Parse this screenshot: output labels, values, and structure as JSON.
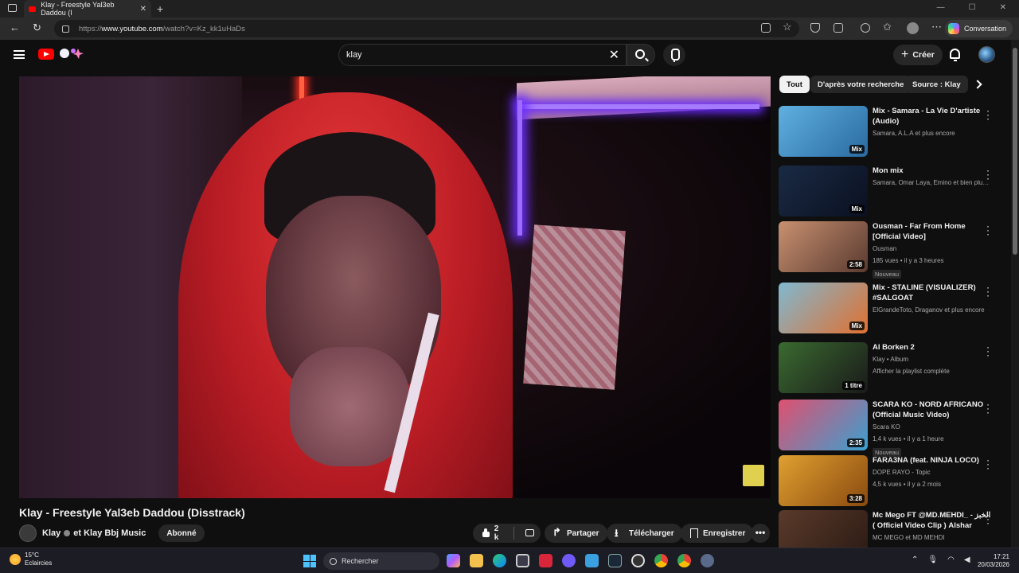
{
  "browser": {
    "tab_title": "Klay - Freestyle Yal3eb Daddou (I",
    "url_prefix": "https://",
    "url_domain": "www.youtube.com",
    "url_path": "/watch?v=Kz_kk1uHaDs",
    "conversation_label": "Conversation"
  },
  "youtube": {
    "search_value": "klay",
    "create_label": "Créer"
  },
  "video": {
    "title": "Klay - Freestyle Yal3eb Daddou (Disstrack)",
    "channel_names": "Klay",
    "channel_joiner": "et Klay Bbj Music",
    "subscribed_label": "Abonné",
    "likes": "2 k",
    "share_label": "Partager",
    "download_label": "Télécharger",
    "save_label": "Enregistrer",
    "more_label": "•••"
  },
  "chips": [
    "Tout",
    "D'après votre recherche",
    "Source : Klay"
  ],
  "recommendations": [
    {
      "title": "Mix - Samara - La Vie D'artiste (Audio)",
      "meta1": "Samara, A.L.A et plus encore",
      "meta2": "",
      "badge": "Mix",
      "nouveau": "",
      "colors": [
        "#5fb0e0",
        "#2a6aa0"
      ]
    },
    {
      "title": "Mon mix",
      "meta1": "Samara, Omar Laya, Emino et bien plus e...",
      "meta2": "",
      "badge": "Mix",
      "nouveau": "",
      "colors": [
        "#1a2a44",
        "#0a1020"
      ]
    },
    {
      "title": "Ousman - Far From Home [Official Video]",
      "meta1": "Ousman",
      "meta2": "185 vues • il y a 3 heures",
      "badge": "2:58",
      "nouveau": "Nouveau",
      "colors": [
        "#c89070",
        "#5a3a30"
      ]
    },
    {
      "title": "Mix - STALINE (VISUALIZER) #SALGOAT",
      "meta1": "ElGrandeToto, Draganov et plus encore",
      "meta2": "",
      "badge": "Mix",
      "nouveau": "",
      "colors": [
        "#80b8d0",
        "#e07030"
      ]
    },
    {
      "title": "Al Borken 2",
      "meta1": "Klay • Album",
      "meta2": "Afficher la playlist complète",
      "badge": "1 titre",
      "nouveau": "",
      "colors": [
        "#3a6a30",
        "#1a1a1a"
      ]
    },
    {
      "title": "SCARA KO - NORD AFRICANO (Official Music Video)",
      "meta1": "Scara KO",
      "meta2": "1,4 k vues • il y a 1 heure",
      "badge": "2:35",
      "nouveau": "Nouveau",
      "colors": [
        "#e05070",
        "#3aa0d0"
      ]
    },
    {
      "title": "FARA3NA (feat. NINJA LOCO)",
      "meta1": "DOPE RAYO - Topic",
      "meta2": "4,5 k vues • il y a 2 mois",
      "badge": "3:28",
      "nouveau": "",
      "colors": [
        "#e0a030",
        "#8a4a10"
      ]
    },
    {
      "title": "Mc Mego FT @MD.MEHDI_ - الخبز ( Officiel Video Clip ) Alshar",
      "meta1": "MC MEGO et MD MEHDI",
      "meta2": "",
      "badge": "",
      "nouveau": "",
      "colors": [
        "#5a3a2a",
        "#2a1a14"
      ]
    }
  ],
  "taskbar": {
    "temp": "15°C",
    "weather": "Eclaircies",
    "search_label": "Rechercher",
    "time": "17:21",
    "date": "20/03/2026"
  }
}
